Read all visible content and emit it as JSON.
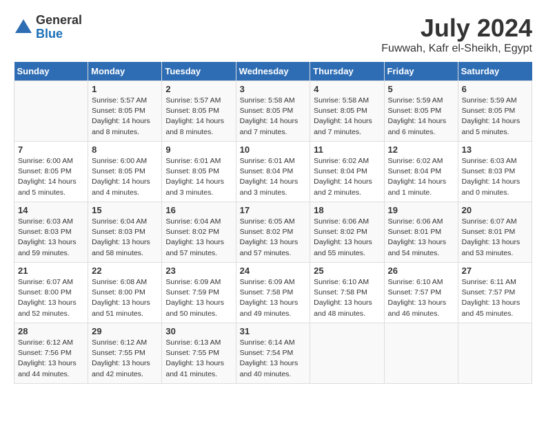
{
  "header": {
    "logo_general": "General",
    "logo_blue": "Blue",
    "month_year": "July 2024",
    "location": "Fuwwah, Kafr el-Sheikh, Egypt"
  },
  "columns": [
    "Sunday",
    "Monday",
    "Tuesday",
    "Wednesday",
    "Thursday",
    "Friday",
    "Saturday"
  ],
  "weeks": [
    [
      {
        "num": "",
        "info": ""
      },
      {
        "num": "1",
        "info": "Sunrise: 5:57 AM\nSunset: 8:05 PM\nDaylight: 14 hours\nand 8 minutes."
      },
      {
        "num": "2",
        "info": "Sunrise: 5:57 AM\nSunset: 8:05 PM\nDaylight: 14 hours\nand 8 minutes."
      },
      {
        "num": "3",
        "info": "Sunrise: 5:58 AM\nSunset: 8:05 PM\nDaylight: 14 hours\nand 7 minutes."
      },
      {
        "num": "4",
        "info": "Sunrise: 5:58 AM\nSunset: 8:05 PM\nDaylight: 14 hours\nand 7 minutes."
      },
      {
        "num": "5",
        "info": "Sunrise: 5:59 AM\nSunset: 8:05 PM\nDaylight: 14 hours\nand 6 minutes."
      },
      {
        "num": "6",
        "info": "Sunrise: 5:59 AM\nSunset: 8:05 PM\nDaylight: 14 hours\nand 5 minutes."
      }
    ],
    [
      {
        "num": "7",
        "info": "Sunrise: 6:00 AM\nSunset: 8:05 PM\nDaylight: 14 hours\nand 5 minutes."
      },
      {
        "num": "8",
        "info": "Sunrise: 6:00 AM\nSunset: 8:05 PM\nDaylight: 14 hours\nand 4 minutes."
      },
      {
        "num": "9",
        "info": "Sunrise: 6:01 AM\nSunset: 8:05 PM\nDaylight: 14 hours\nand 3 minutes."
      },
      {
        "num": "10",
        "info": "Sunrise: 6:01 AM\nSunset: 8:04 PM\nDaylight: 14 hours\nand 3 minutes."
      },
      {
        "num": "11",
        "info": "Sunrise: 6:02 AM\nSunset: 8:04 PM\nDaylight: 14 hours\nand 2 minutes."
      },
      {
        "num": "12",
        "info": "Sunrise: 6:02 AM\nSunset: 8:04 PM\nDaylight: 14 hours\nand 1 minute."
      },
      {
        "num": "13",
        "info": "Sunrise: 6:03 AM\nSunset: 8:03 PM\nDaylight: 14 hours\nand 0 minutes."
      }
    ],
    [
      {
        "num": "14",
        "info": "Sunrise: 6:03 AM\nSunset: 8:03 PM\nDaylight: 13 hours\nand 59 minutes."
      },
      {
        "num": "15",
        "info": "Sunrise: 6:04 AM\nSunset: 8:03 PM\nDaylight: 13 hours\nand 58 minutes."
      },
      {
        "num": "16",
        "info": "Sunrise: 6:04 AM\nSunset: 8:02 PM\nDaylight: 13 hours\nand 57 minutes."
      },
      {
        "num": "17",
        "info": "Sunrise: 6:05 AM\nSunset: 8:02 PM\nDaylight: 13 hours\nand 57 minutes."
      },
      {
        "num": "18",
        "info": "Sunrise: 6:06 AM\nSunset: 8:02 PM\nDaylight: 13 hours\nand 55 minutes."
      },
      {
        "num": "19",
        "info": "Sunrise: 6:06 AM\nSunset: 8:01 PM\nDaylight: 13 hours\nand 54 minutes."
      },
      {
        "num": "20",
        "info": "Sunrise: 6:07 AM\nSunset: 8:01 PM\nDaylight: 13 hours\nand 53 minutes."
      }
    ],
    [
      {
        "num": "21",
        "info": "Sunrise: 6:07 AM\nSunset: 8:00 PM\nDaylight: 13 hours\nand 52 minutes."
      },
      {
        "num": "22",
        "info": "Sunrise: 6:08 AM\nSunset: 8:00 PM\nDaylight: 13 hours\nand 51 minutes."
      },
      {
        "num": "23",
        "info": "Sunrise: 6:09 AM\nSunset: 7:59 PM\nDaylight: 13 hours\nand 50 minutes."
      },
      {
        "num": "24",
        "info": "Sunrise: 6:09 AM\nSunset: 7:58 PM\nDaylight: 13 hours\nand 49 minutes."
      },
      {
        "num": "25",
        "info": "Sunrise: 6:10 AM\nSunset: 7:58 PM\nDaylight: 13 hours\nand 48 minutes."
      },
      {
        "num": "26",
        "info": "Sunrise: 6:10 AM\nSunset: 7:57 PM\nDaylight: 13 hours\nand 46 minutes."
      },
      {
        "num": "27",
        "info": "Sunrise: 6:11 AM\nSunset: 7:57 PM\nDaylight: 13 hours\nand 45 minutes."
      }
    ],
    [
      {
        "num": "28",
        "info": "Sunrise: 6:12 AM\nSunset: 7:56 PM\nDaylight: 13 hours\nand 44 minutes."
      },
      {
        "num": "29",
        "info": "Sunrise: 6:12 AM\nSunset: 7:55 PM\nDaylight: 13 hours\nand 42 minutes."
      },
      {
        "num": "30",
        "info": "Sunrise: 6:13 AM\nSunset: 7:55 PM\nDaylight: 13 hours\nand 41 minutes."
      },
      {
        "num": "31",
        "info": "Sunrise: 6:14 AM\nSunset: 7:54 PM\nDaylight: 13 hours\nand 40 minutes."
      },
      {
        "num": "",
        "info": ""
      },
      {
        "num": "",
        "info": ""
      },
      {
        "num": "",
        "info": ""
      }
    ]
  ]
}
